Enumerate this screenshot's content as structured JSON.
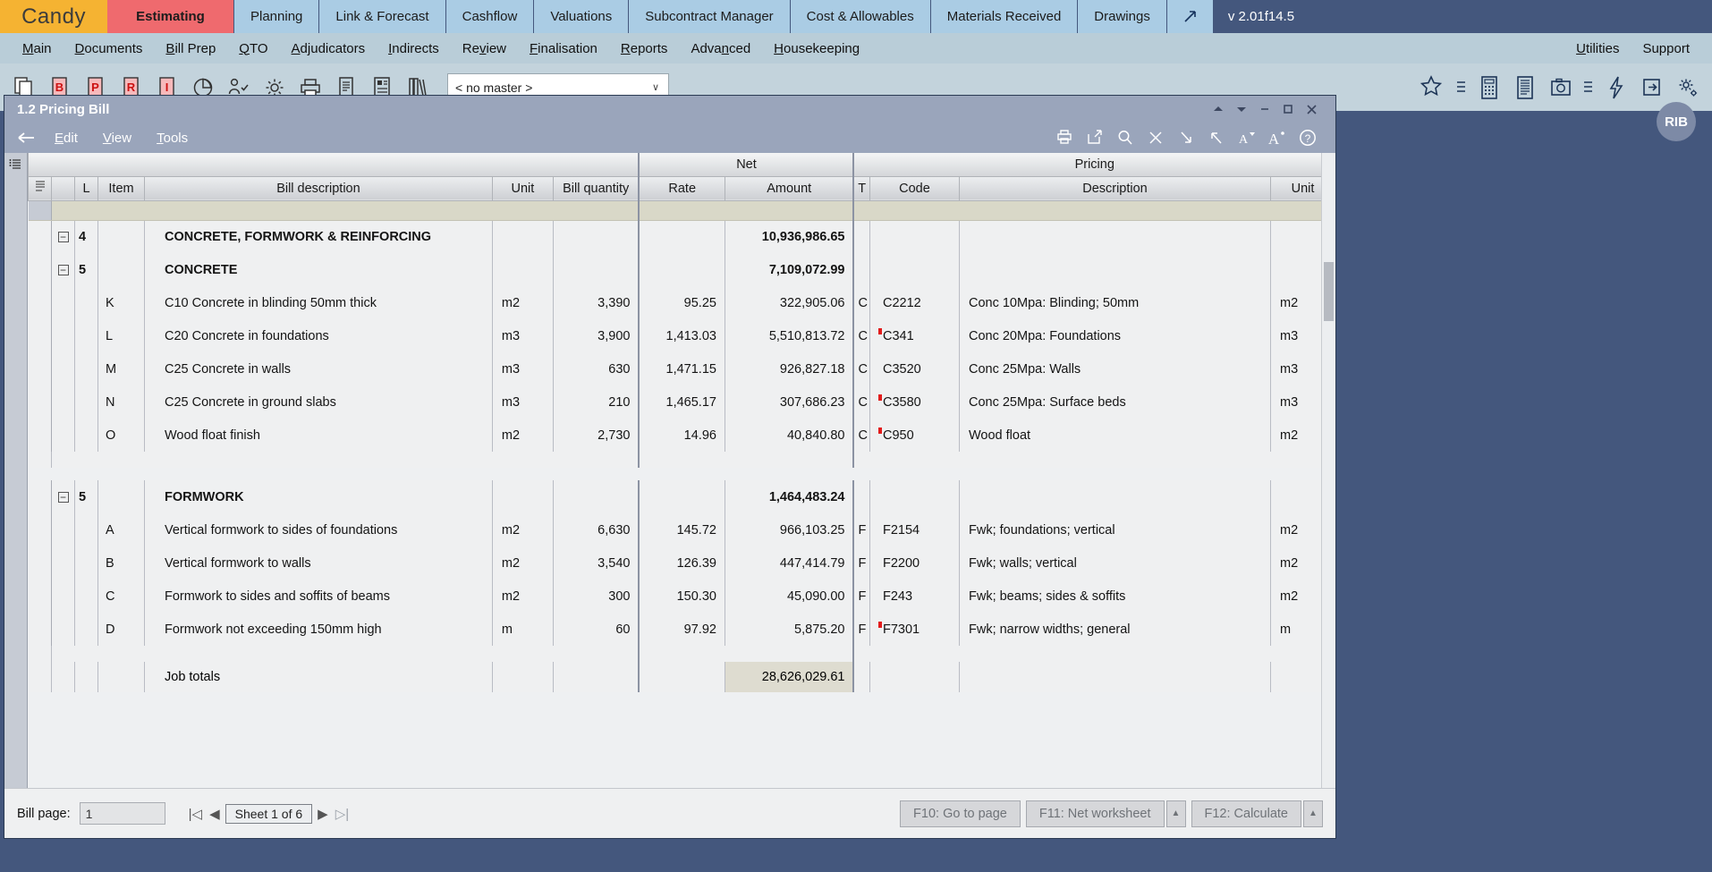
{
  "app": {
    "brand": "Candy",
    "version": "v 2.01f14.5",
    "avatar": "RIB"
  },
  "top_tabs": [
    {
      "label": "Estimating",
      "active": true
    },
    {
      "label": "Planning",
      "active": false
    },
    {
      "label": "Link & Forecast",
      "active": false
    },
    {
      "label": "Cashflow",
      "active": false
    },
    {
      "label": "Valuations",
      "active": false
    },
    {
      "label": "Subcontract Manager",
      "active": false
    },
    {
      "label": "Cost & Allowables",
      "active": false
    },
    {
      "label": "Materials Received",
      "active": false
    },
    {
      "label": "Drawings",
      "active": false
    }
  ],
  "menubar": {
    "left": [
      "Main",
      "Documents",
      "Bill Prep",
      "QTO",
      "Adjudicators",
      "Indirects",
      "Review",
      "Finalisation",
      "Reports",
      "Advanced",
      "Housekeeping"
    ],
    "right": [
      "Utilities",
      "Support"
    ]
  },
  "toolbar": {
    "icons": [
      "copy-icon",
      "bill-b-icon",
      "page-p-icon",
      "page-r-icon",
      "page-i-icon",
      "pie-chart-icon",
      "people-icon",
      "gear-icon",
      "print-icon",
      "document-icon",
      "layout-icon",
      "books-icon"
    ],
    "master_select": {
      "value": "< no master >",
      "chevron": "∨"
    },
    "right_icons": [
      "star-icon",
      "star-list-icon",
      "calculator-icon",
      "register-icon",
      "camera-icon",
      "camera-list-icon",
      "lightning-icon",
      "export-icon",
      "settings-gear-icon"
    ]
  },
  "window": {
    "title": "1.2 Pricing Bill",
    "menu": [
      "Edit",
      "View",
      "Tools"
    ],
    "back_icon": "back-arrow-icon",
    "controls": [
      "scroll-up-icon",
      "scroll-down-icon",
      "minimize-icon",
      "maximize-icon",
      "close-icon"
    ],
    "tools": [
      "print-icon",
      "export-icon",
      "search-icon",
      "close-x-icon",
      "arrow-down-right-icon",
      "arrow-up-left-icon",
      "font-decrease-icon",
      "font-increase-icon",
      "help-icon"
    ]
  },
  "grid": {
    "group_headers": [
      {
        "label": "",
        "span": "left"
      },
      {
        "label": "Net",
        "span": "net"
      },
      {
        "label": "Pricing",
        "span": "pricing"
      }
    ],
    "columns": {
      "l": "L",
      "item": "Item",
      "bill_description": "Bill description",
      "unit": "Unit",
      "bill_quantity": "Bill quantity",
      "net_rate": "Rate",
      "net_amount": "Amount",
      "t": "T",
      "code": "Code",
      "pricing_description": "Description",
      "pricing_unit": "Unit"
    },
    "rows": [
      {
        "kind": "group",
        "level": "4",
        "expandable": true,
        "color": "orange",
        "item": "",
        "description": "CONCRETE, FORMWORK & REINFORCING",
        "unit": "",
        "quantity": "",
        "rate": "",
        "amount": "10,936,986.65",
        "t": "",
        "code": "",
        "code_flag": false,
        "pricing_description": "",
        "pricing_unit": ""
      },
      {
        "kind": "group",
        "level": "5",
        "expandable": true,
        "color": "blue",
        "indent": true,
        "item": "",
        "description": "CONCRETE",
        "unit": "",
        "quantity": "",
        "rate": "",
        "amount": "7,109,072.99",
        "t": "",
        "code": "",
        "code_flag": false,
        "pricing_description": "",
        "pricing_unit": ""
      },
      {
        "kind": "item",
        "level": "",
        "item": "K",
        "description": "C10 Concrete in blinding 50mm thick",
        "unit": "m2",
        "quantity": "3,390",
        "rate": "95.25",
        "amount": "322,905.06",
        "t": "C",
        "code": "C2212",
        "code_flag": false,
        "pricing_description": "Conc 10Mpa: Blinding; 50mm",
        "pricing_unit": "m2"
      },
      {
        "kind": "item",
        "level": "",
        "item": "L",
        "description": "C20 Concrete in foundations",
        "unit": "m3",
        "quantity": "3,900",
        "rate": "1,413.03",
        "amount": "5,510,813.72",
        "t": "C",
        "code": "C341",
        "code_flag": true,
        "pricing_description": "Conc 20Mpa: Foundations",
        "pricing_unit": "m3"
      },
      {
        "kind": "item",
        "level": "",
        "item": "M",
        "description": "C25 Concrete in walls",
        "unit": "m3",
        "quantity": "630",
        "rate": "1,471.15",
        "amount": "926,827.18",
        "t": "C",
        "code": "C3520",
        "code_flag": false,
        "pricing_description": "Conc 25Mpa: Walls",
        "pricing_unit": "m3"
      },
      {
        "kind": "item",
        "level": "",
        "item": "N",
        "description": "C25 Concrete in ground slabs",
        "unit": "m3",
        "quantity": "210",
        "rate": "1,465.17",
        "amount": "307,686.23",
        "t": "C",
        "code": "C3580",
        "code_flag": true,
        "pricing_description": "Conc 25Mpa: Surface beds",
        "pricing_unit": "m3"
      },
      {
        "kind": "item",
        "level": "",
        "item": "O",
        "description": "Wood float finish",
        "unit": "m2",
        "quantity": "2,730",
        "rate": "14.96",
        "amount": "40,840.80",
        "t": "C",
        "code": "C950",
        "code_flag": true,
        "pricing_description": "Wood float",
        "pricing_unit": "m2"
      },
      {
        "kind": "group",
        "level": "5",
        "expandable": true,
        "color": "blue",
        "indent": true,
        "item": "",
        "description": "FORMWORK",
        "unit": "",
        "quantity": "",
        "rate": "",
        "amount": "1,464,483.24",
        "t": "",
        "code": "",
        "code_flag": false,
        "pricing_description": "",
        "pricing_unit": ""
      },
      {
        "kind": "item",
        "level": "",
        "item": "A",
        "description": "Vertical formwork to sides of foundations",
        "unit": "m2",
        "quantity": "6,630",
        "rate": "145.72",
        "amount": "966,103.25",
        "t": "F",
        "code": "F2154",
        "code_flag": false,
        "pricing_description": "Fwk; foundations; vertical",
        "pricing_unit": "m2"
      },
      {
        "kind": "item",
        "level": "",
        "item": "B",
        "description": "Vertical formwork to walls",
        "unit": "m2",
        "quantity": "3,540",
        "rate": "126.39",
        "amount": "447,414.79",
        "t": "F",
        "code": "F2200",
        "code_flag": false,
        "pricing_description": "Fwk; walls; vertical",
        "pricing_unit": "m2"
      },
      {
        "kind": "item",
        "level": "",
        "item": "C",
        "description": "Formwork to sides and soffits of beams",
        "unit": "m2",
        "quantity": "300",
        "rate": "150.30",
        "amount": "45,090.00",
        "t": "F",
        "code": "F243",
        "code_flag": false,
        "pricing_description": "Fwk; beams; sides & soffits",
        "pricing_unit": "m2"
      },
      {
        "kind": "item",
        "level": "",
        "item": "D",
        "description": "Formwork not exceeding 150mm high",
        "unit": "m",
        "quantity": "60",
        "rate": "97.92",
        "amount": "5,875.20",
        "t": "F",
        "code": "F7301",
        "code_flag": true,
        "pricing_description": "Fwk; narrow widths; general",
        "pricing_unit": "m"
      }
    ],
    "totals": {
      "label": "Job totals",
      "amount": "28,626,029.61"
    }
  },
  "footer": {
    "bill_page_label": "Bill page:",
    "bill_page_value": "1",
    "nav_first": "|◁",
    "nav_prev": "◀",
    "sheet_label": "Sheet 1 of 6",
    "nav_next": "▶",
    "nav_last": "▷|",
    "buttons": [
      {
        "label": "F10: Go to page"
      },
      {
        "label": "F11: Net worksheet"
      },
      {
        "label": "F12: Calculate"
      }
    ]
  }
}
